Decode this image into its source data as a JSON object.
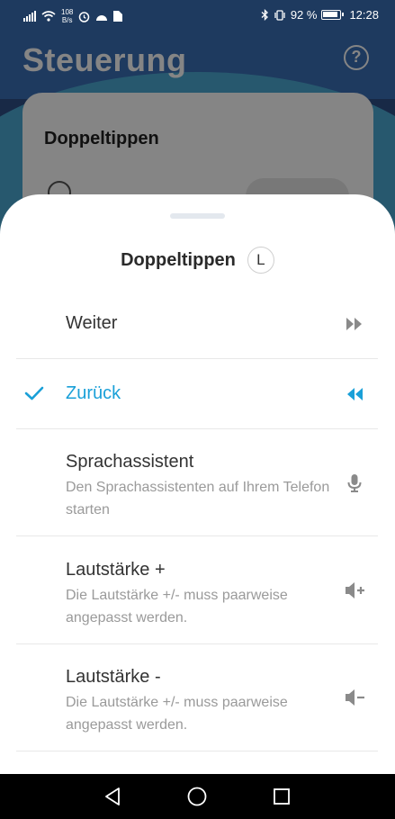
{
  "status_bar": {
    "net_speed_value": "108",
    "net_speed_unit": "B/s",
    "battery_text": "92 %",
    "battery_level": 0.92,
    "time": "12:28"
  },
  "background_screen": {
    "title": "Steuerung",
    "card_title": "Doppeltippen"
  },
  "sheet": {
    "title": "Doppeltippen",
    "side_badge": "L",
    "accent_color": "#1aa0d8",
    "options": [
      {
        "label": "Weiter",
        "description": "",
        "icon": "fast-forward-icon",
        "selected": false
      },
      {
        "label": "Zurück",
        "description": "",
        "icon": "rewind-icon",
        "selected": true
      },
      {
        "label": "Sprachassistent",
        "description": "Den Sprachassistenten auf Ihrem Telefon starten",
        "icon": "microphone-icon",
        "selected": false
      },
      {
        "label": "Lautstärke +",
        "description": "Die Lautstärke +/- muss paarweise angepasst werden.",
        "icon": "volume-up-icon",
        "selected": false
      },
      {
        "label": "Lautstärke -",
        "description": "Die Lautstärke +/- muss paarweise angepasst werden.",
        "icon": "volume-down-icon",
        "selected": false
      }
    ]
  },
  "nav_bar": {
    "buttons": [
      "back-icon",
      "home-icon",
      "recents-icon"
    ]
  }
}
